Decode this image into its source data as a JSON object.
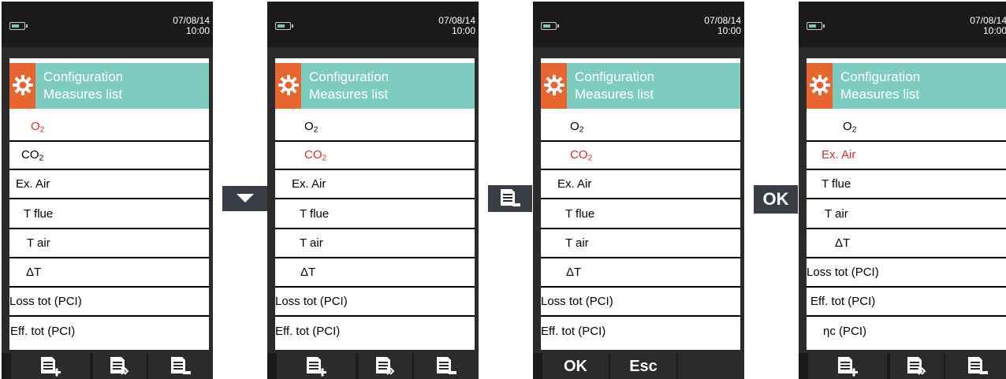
{
  "screens": [
    {
      "datetime": "07/08/14\n10:00",
      "header": {
        "line1": "Configuration",
        "line2": "Measures list"
      },
      "selected_index": 0,
      "items": [
        "O₂",
        "CO₂",
        "Ex. Air",
        "T flue",
        "T air",
        "ΔT",
        "Loss tot (PCI)",
        "Eff. tot (PCI)"
      ],
      "buttons": [
        {
          "icon": "add-list-icon"
        },
        {
          "icon": "move-list-icon"
        },
        {
          "icon": "remove-list-icon"
        }
      ]
    },
    {
      "datetime": "07/08/14\n10:00",
      "header": {
        "line1": "Configuration",
        "line2": "Measures list"
      },
      "selected_index": 1,
      "items": [
        "O₂",
        "CO₂",
        "Ex. Air",
        "T flue",
        "T air",
        "ΔT",
        "Loss tot (PCI)",
        "Eff. tot (PCI)"
      ],
      "buttons": [
        {
          "icon": "add-list-icon"
        },
        {
          "icon": "move-list-icon"
        },
        {
          "icon": "remove-list-icon"
        }
      ]
    },
    {
      "datetime": "07/08/14\n10:00",
      "header": {
        "line1": "Configuration",
        "line2": "Measures list"
      },
      "selected_index": 1,
      "items": [
        "O₂",
        "CO₂",
        "Ex. Air",
        "T flue",
        "T air",
        "ΔT",
        "Loss tot (PCI)",
        "Eff. tot (PCI)"
      ],
      "buttons": [
        {
          "label": "OK"
        },
        {
          "label": "Esc"
        },
        {
          "label": ""
        }
      ]
    },
    {
      "datetime": "07/08/14\n10:00",
      "header": {
        "line1": "Configuration",
        "line2": "Measures list"
      },
      "selected_index": 1,
      "items": [
        "O₂",
        "Ex. Air",
        "T flue",
        "T air",
        "ΔT",
        "Loss tot (PCI)",
        "Eff. tot (PCI)",
        "ηc (PCI)"
      ],
      "buttons": [
        {
          "icon": "add-list-icon"
        },
        {
          "icon": "move-list-icon"
        },
        {
          "icon": "remove-list-icon"
        }
      ]
    }
  ],
  "transitions": [
    {
      "icon": "down-arrow-icon"
    },
    {
      "icon": "remove-list-icon"
    },
    {
      "label": "OK"
    }
  ],
  "colors": {
    "header_bg": "#7ecbbf",
    "gear_bg": "#e8652f",
    "selected_text": "#e22727",
    "device_body": "#2b2b2b"
  }
}
